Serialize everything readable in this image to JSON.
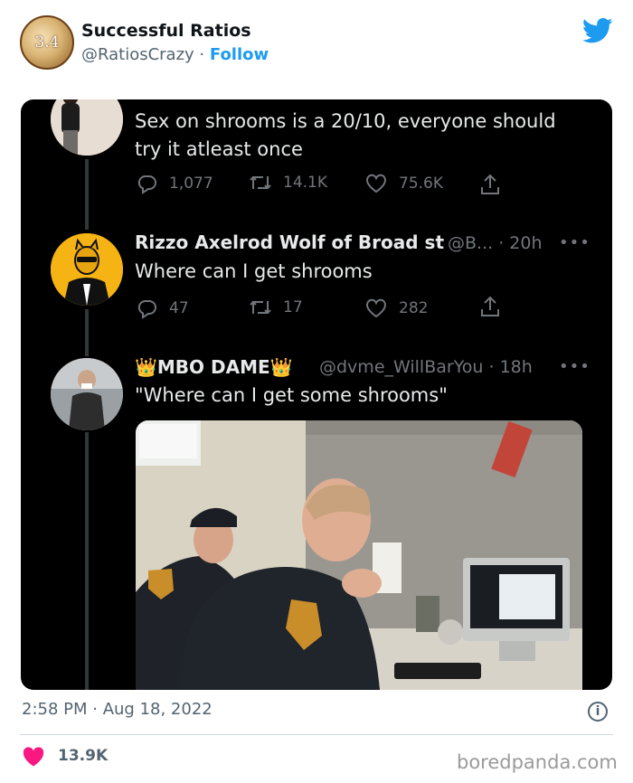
{
  "header": {
    "avatar_text": "3.4",
    "display_name": "Successful Ratios",
    "handle": "@RatiosCrazy",
    "separator": " · ",
    "follow_label": "Follow"
  },
  "screenshot": {
    "tweets": [
      {
        "text_line1": "Sex on shrooms is a 20/10, everyone should",
        "text_line2": "try it atleast once",
        "replies": "1,077",
        "retweets": "14.1K",
        "likes": "75.6K"
      },
      {
        "name": "Rizzo Axelrod Wolf of Broad st",
        "handle_time": "@B... · 20h",
        "text": "Where can I get shrooms",
        "replies": "47",
        "retweets": "17",
        "likes": "282"
      },
      {
        "name_prefix_emoji": "👑",
        "name": "MBO DAME",
        "name_suffix_emoji": "👑",
        "handle_time": "@dvme_WillBarYou · 18h",
        "text": "\"Where can I get some shrooms\""
      }
    ],
    "more_glyph": "•••"
  },
  "footer": {
    "timestamp": "2:58 PM · Aug 18, 2022",
    "info_glyph": "i",
    "like_count": "13.9K",
    "watermark": "boredpanda.com"
  },
  "colors": {
    "twitter_blue": "#1d9bf0",
    "heart_pink": "#f91880",
    "dark_bg": "#000000",
    "muted_text": "#536471"
  }
}
